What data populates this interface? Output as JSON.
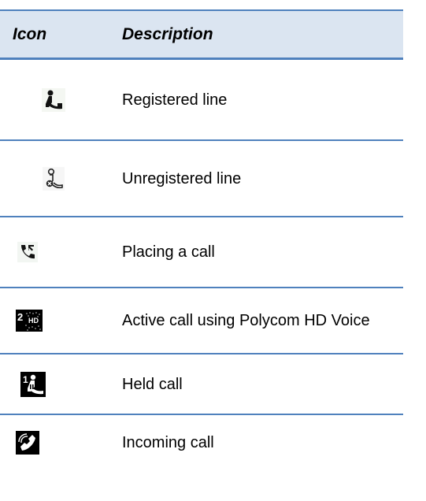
{
  "table": {
    "header": {
      "icon": "Icon",
      "description": "Description"
    },
    "rows": [
      {
        "icon": "registered-line-icon",
        "description": "Registered line"
      },
      {
        "icon": "unregistered-line-icon",
        "description": "Unregistered line"
      },
      {
        "icon": "placing-call-icon",
        "description": "Placing a call"
      },
      {
        "icon": "hd-voice-active-call-icon",
        "description": "Active call using Polycom HD Voice"
      },
      {
        "icon": "held-call-icon",
        "description": "Held call"
      },
      {
        "icon": "incoming-call-icon",
        "description": "Incoming call"
      }
    ]
  },
  "colors": {
    "rule": "#4f81bd",
    "header_bg": "#dbe5f1",
    "icon_bg_dark": "#000000"
  }
}
